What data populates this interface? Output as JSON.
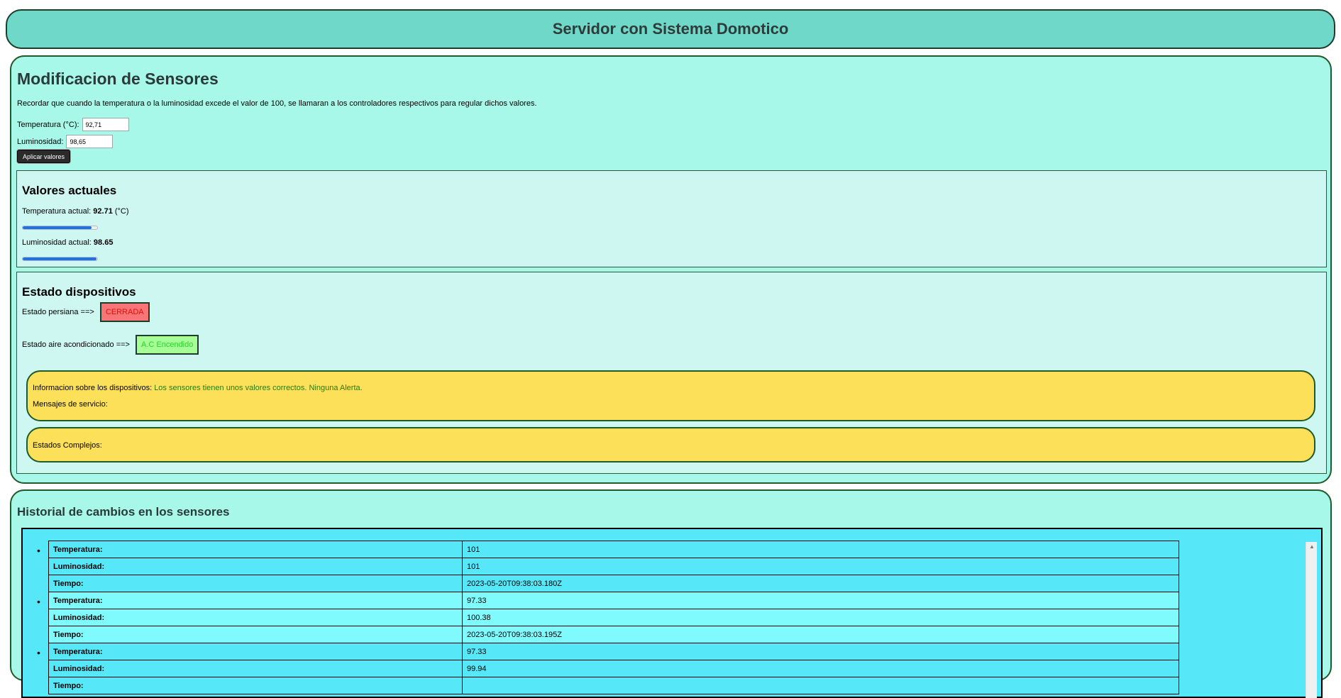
{
  "header": {
    "title": "Servidor con Sistema Domotico"
  },
  "sensors": {
    "title": "Modificacion de Sensores",
    "note": "Recordar que cuando la temperatura o la luminosidad excede el valor de 100, se llamaran a los controladores respectivos para regular dichos valores.",
    "temp_label": "Temperatura (°C):",
    "temp_value": "92,71",
    "lum_label": "Luminosidad:",
    "lum_value": "98,65",
    "apply_label": "Aplicar valores"
  },
  "current": {
    "title": "Valores actuales",
    "temp_prefix": "Temperatura actual: ",
    "temp_value": "92.71",
    "temp_unit": " (°C)",
    "temp_fill": 0.9271,
    "lum_prefix": "Luminosidad actual: ",
    "lum_value": "98.65",
    "lum_fill": 0.9865
  },
  "devices": {
    "title": "Estado dispositivos",
    "blind_label": "Estado persiana ==>",
    "blind_state": "CERRADA",
    "ac_label": "Estado aire acondicionado ==>",
    "ac_state": "A.C Encendido",
    "info_label": "Informacion sobre los dispositivos: ",
    "info_text": "Los sensores tienen unos valores correctos. Ninguna Alerta.",
    "service_label": "Mensajes de servicio:",
    "complex_label": "Estados Complejos:"
  },
  "history": {
    "title": "Historial de cambios en los sensores",
    "keys": {
      "temp": "Temperatura:",
      "lum": "Luminosidad:",
      "time": "Tiempo:"
    },
    "entries": [
      {
        "temp": "101",
        "lum": "101",
        "time": "2023-05-20T09:38:03.180Z"
      },
      {
        "temp": "97.33",
        "lum": "100.38",
        "time": "2023-05-20T09:38:03.195Z"
      },
      {
        "temp": "97.33",
        "lum": "99.94",
        "time": ""
      }
    ]
  },
  "colors": {
    "header_bg": "#6fd8c8",
    "panel_bg": "#a8f8ea",
    "box_bg": "#cff7f2",
    "yellow_bg": "#fde05a",
    "progress": "#1a74e8",
    "badge_red": "#f87575",
    "badge_green": "#a6ff96"
  }
}
